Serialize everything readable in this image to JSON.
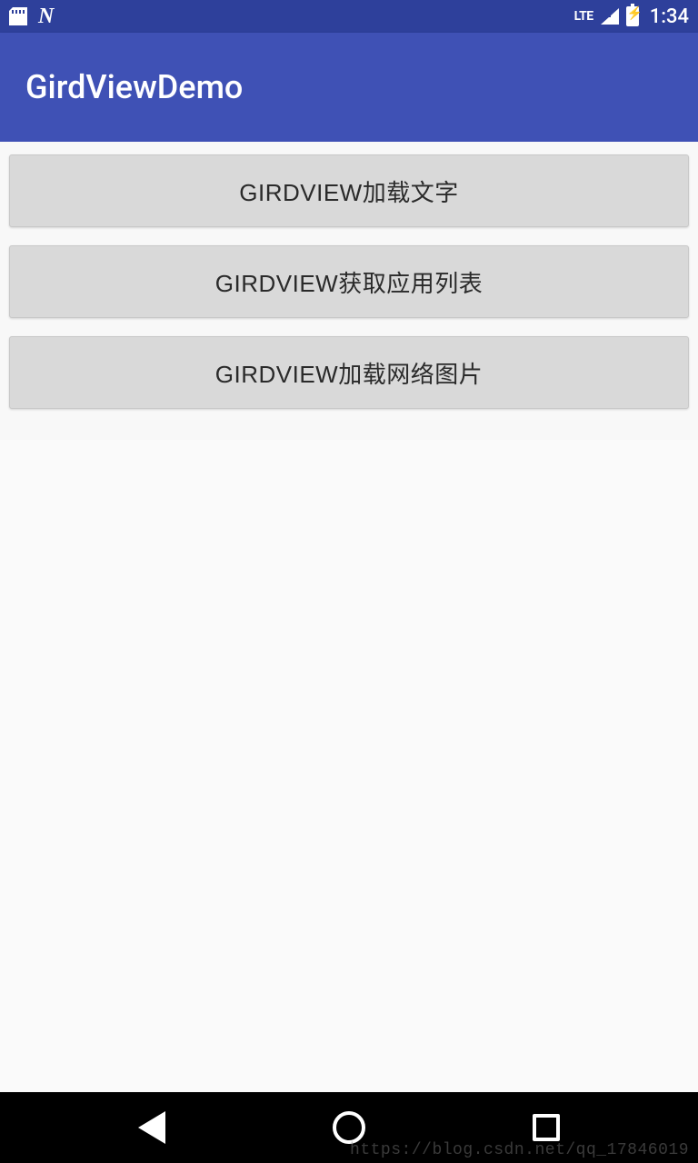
{
  "status_bar": {
    "lte_label": "LTE",
    "time": "1:34"
  },
  "app_bar": {
    "title": "GirdViewDemo"
  },
  "buttons": [
    {
      "label": "GIRDVIEW加载文字"
    },
    {
      "label": "GIRDVIEW获取应用列表"
    },
    {
      "label": "GIRDVIEW加载网络图片"
    }
  ],
  "watermark": "https://blog.csdn.net/qq_17846019",
  "colors": {
    "status_bar_bg": "#2e409b",
    "app_bar_bg": "#3f51b5",
    "button_bg": "#d9d9d9"
  }
}
